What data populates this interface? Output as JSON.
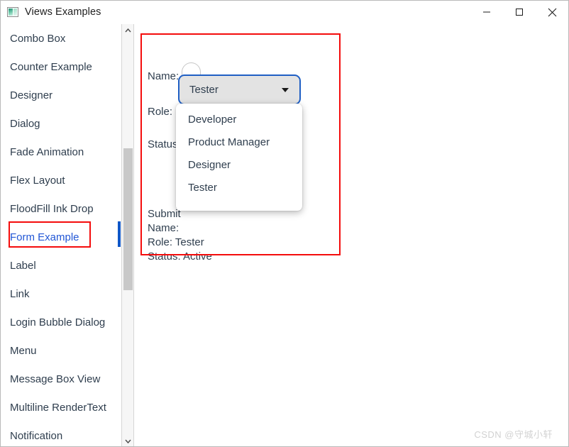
{
  "window": {
    "title": "Views Examples",
    "icon": "image-icon",
    "controls": [
      {
        "name": "minimize-button",
        "glyph": "minimize-icon"
      },
      {
        "name": "maximize-button",
        "glyph": "maximize-icon"
      },
      {
        "name": "close-button",
        "glyph": "close-icon"
      }
    ]
  },
  "sidebar": {
    "items": [
      {
        "label": "Combo Box",
        "selected": false
      },
      {
        "label": "Counter Example",
        "selected": false
      },
      {
        "label": "Designer",
        "selected": false
      },
      {
        "label": "Dialog",
        "selected": false
      },
      {
        "label": "Fade Animation",
        "selected": false
      },
      {
        "label": "Flex Layout",
        "selected": false
      },
      {
        "label": "FloodFill Ink Drop",
        "selected": false
      },
      {
        "label": "Form Example",
        "selected": true
      },
      {
        "label": "Label",
        "selected": false
      },
      {
        "label": "Link",
        "selected": false
      },
      {
        "label": "Login Bubble Dialog",
        "selected": false
      },
      {
        "label": "Menu",
        "selected": false
      },
      {
        "label": "Message Box View",
        "selected": false
      },
      {
        "label": "Multiline RenderText",
        "selected": false
      },
      {
        "label": "Notification",
        "selected": false
      }
    ],
    "scrollbar": {
      "up_arrow": "chevron-up-icon",
      "down_arrow": "chevron-down-icon"
    }
  },
  "form": {
    "labels": {
      "name": "Name:",
      "role": "Role:",
      "status": "Status:"
    },
    "name_value": "",
    "name_placeholder": "",
    "role": {
      "selected": "Tester",
      "arrow": "triangle-down-icon",
      "options": [
        "Developer",
        "Product Manager",
        "Designer",
        "Tester"
      ]
    },
    "output": {
      "line1": "Submit",
      "line2": "Name:",
      "line3": "Role: Tester",
      "line4": "Status: Active"
    }
  },
  "watermark": "CSDN @守城小轩",
  "colors": {
    "accent_blue": "#1f5fc4",
    "selection_blue": "#0f57c8",
    "annotation_red": "#f40c0c",
    "text": "#2f3e4e"
  }
}
